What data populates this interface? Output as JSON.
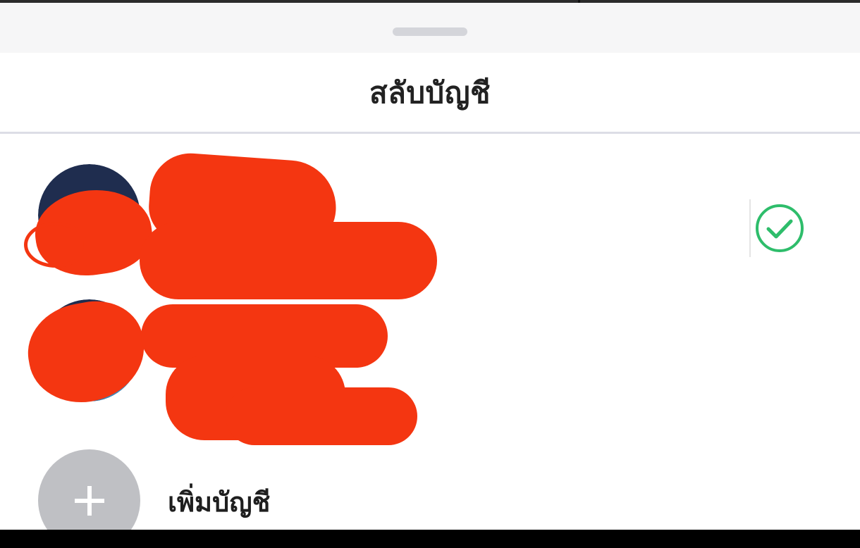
{
  "sheet": {
    "title": "สลับบัญชี"
  },
  "accounts": [
    {
      "selected": true
    },
    {
      "selected": false
    }
  ],
  "add_account": {
    "label": "เพิ่มบัญชี"
  },
  "colors": {
    "check": "#2ebd6b",
    "redaction": "#f43611",
    "add_avatar_bg": "#bfc0c4",
    "divider": "#dcdde6"
  },
  "icons": {
    "selected_indicator": "check-circle-icon",
    "add": "plus-icon"
  }
}
